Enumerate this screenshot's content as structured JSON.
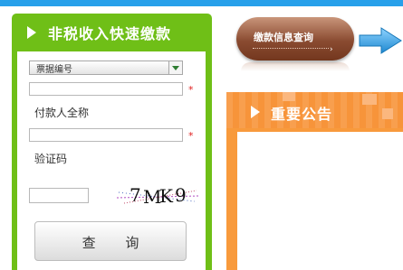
{
  "payment_panel": {
    "title": "非税收入快速缴款",
    "search_type_select": {
      "selected": "票据编号"
    },
    "payer_name_label": "付款人全称",
    "captcha_label": "验证码",
    "required_mark": "*",
    "captcha_text": [
      "7",
      "M",
      "K",
      "9"
    ],
    "query_button": "查 询"
  },
  "payment_info_button": {
    "label": "缴款信息查询",
    "chevron": "›"
  },
  "announcement_panel": {
    "title": "重要公告"
  },
  "colors": {
    "top_strip": "#27a0ea",
    "green_panel": "#6fbf17",
    "brown_button": "#8a4b31",
    "orange_panel": "#f89a3c",
    "required": "#e01e1e",
    "arrow": "#2a9fe0"
  },
  "icons": {
    "arrow": "right-arrow-icon",
    "triangle": "triangle-right-icon",
    "dropdown": "dropdown-arrow-icon"
  }
}
